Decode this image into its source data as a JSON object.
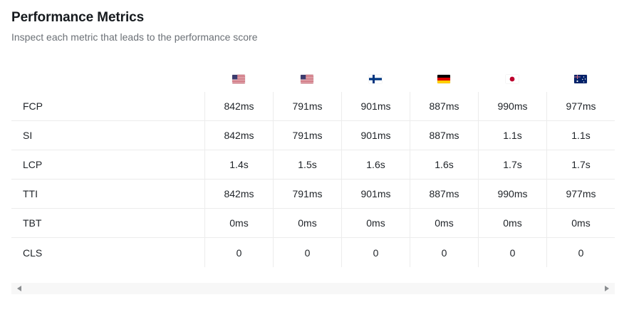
{
  "header": {
    "title": "Performance Metrics",
    "subtitle": "Inspect each metric that leads to the performance score"
  },
  "columns": [
    {
      "flag": "us-flag-icon"
    },
    {
      "flag": "us-flag-icon"
    },
    {
      "flag": "finland-flag-icon"
    },
    {
      "flag": "germany-flag-icon"
    },
    {
      "flag": "japan-flag-icon"
    },
    {
      "flag": "australia-flag-icon"
    }
  ],
  "rows": [
    {
      "metric": "FCP",
      "values": [
        "842ms",
        "791ms",
        "901ms",
        "887ms",
        "990ms",
        "977ms"
      ]
    },
    {
      "metric": "SI",
      "values": [
        "842ms",
        "791ms",
        "901ms",
        "887ms",
        "1.1s",
        "1.1s"
      ]
    },
    {
      "metric": "LCP",
      "values": [
        "1.4s",
        "1.5s",
        "1.6s",
        "1.6s",
        "1.7s",
        "1.7s"
      ]
    },
    {
      "metric": "TTI",
      "values": [
        "842ms",
        "791ms",
        "901ms",
        "887ms",
        "990ms",
        "977ms"
      ]
    },
    {
      "metric": "TBT",
      "values": [
        "0ms",
        "0ms",
        "0ms",
        "0ms",
        "0ms",
        "0ms"
      ]
    },
    {
      "metric": "CLS",
      "values": [
        "0",
        "0",
        "0",
        "0",
        "0",
        "0"
      ]
    }
  ],
  "colors": {
    "border": "#ececec",
    "subtitle": "#6b7076",
    "scrollbar_track": "#f7f7f7"
  }
}
